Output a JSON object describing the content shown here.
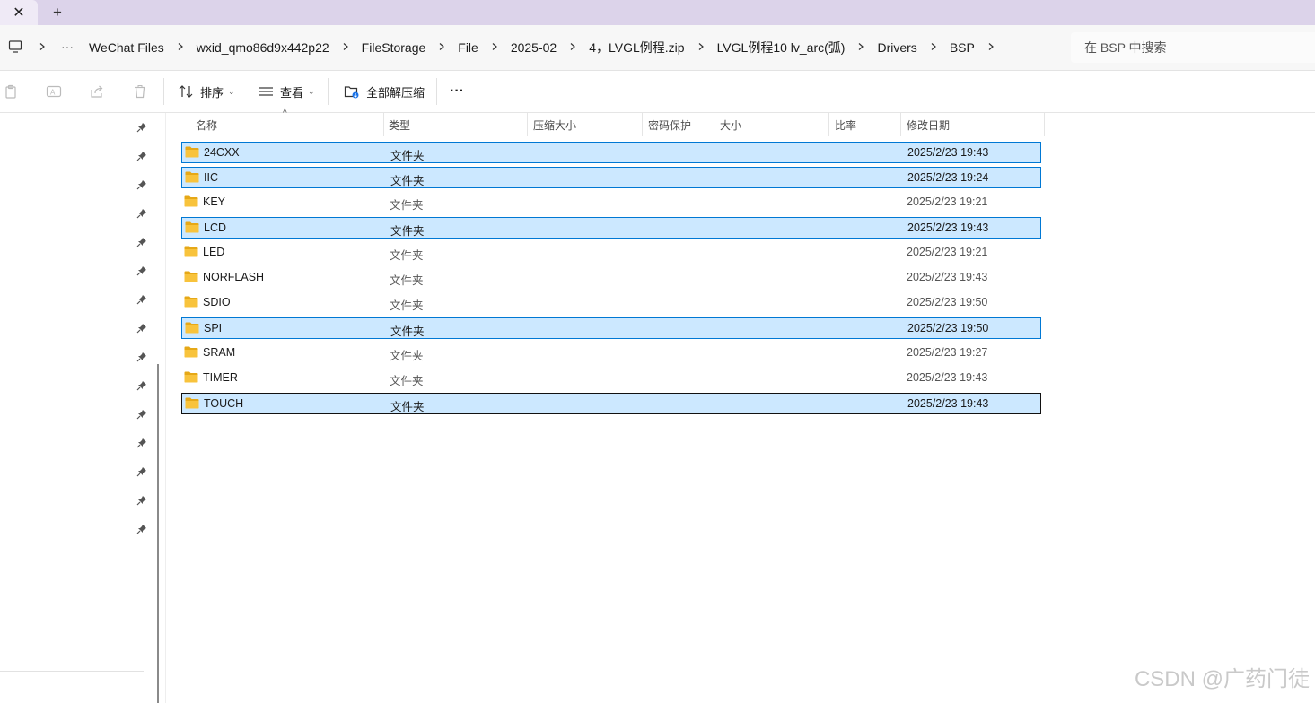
{
  "tabs": {
    "close_symbol": "✕",
    "new_symbol": "+"
  },
  "breadcrumb": {
    "items": [
      "WeChat Files",
      "wxid_qmo86d9x442p22",
      "FileStorage",
      "File",
      "2025-02",
      "4，LVGL例程.zip",
      "LVGL例程10 lv_arc(弧)",
      "Drivers",
      "BSP"
    ]
  },
  "search": {
    "placeholder": "在 BSP 中搜索"
  },
  "commandbar": {
    "sort_label": "排序",
    "view_label": "查看",
    "extract_label": "全部解压缩",
    "more_label": "···"
  },
  "columns": [
    "名称",
    "类型",
    "压缩大小",
    "密码保护",
    "大小",
    "比率",
    "修改日期"
  ],
  "rows": [
    {
      "name": "24CXX",
      "type": "文件夹",
      "date": "2025/2/23 19:43",
      "state": "selected"
    },
    {
      "name": "IIC",
      "type": "文件夹",
      "date": "2025/2/23 19:24",
      "state": "selected"
    },
    {
      "name": "KEY",
      "type": "文件夹",
      "date": "2025/2/23 19:21",
      "state": "normal"
    },
    {
      "name": "LCD",
      "type": "文件夹",
      "date": "2025/2/23 19:43",
      "state": "selected"
    },
    {
      "name": "LED",
      "type": "文件夹",
      "date": "2025/2/23 19:21",
      "state": "normal"
    },
    {
      "name": "NORFLASH",
      "type": "文件夹",
      "date": "2025/2/23 19:43",
      "state": "normal"
    },
    {
      "name": "SDIO",
      "type": "文件夹",
      "date": "2025/2/23 19:50",
      "state": "normal"
    },
    {
      "name": "SPI",
      "type": "文件夹",
      "date": "2025/2/23 19:50",
      "state": "selected"
    },
    {
      "name": "SRAM",
      "type": "文件夹",
      "date": "2025/2/23 19:27",
      "state": "normal"
    },
    {
      "name": "TIMER",
      "type": "文件夹",
      "date": "2025/2/23 19:43",
      "state": "normal"
    },
    {
      "name": "TOUCH",
      "type": "文件夹",
      "date": "2025/2/23 19:43",
      "state": "focused"
    }
  ],
  "watermark": "CSDN @广药门徒",
  "colors": {
    "selection_bg": "#cce8ff",
    "selection_border": "#0078d4",
    "tabstrip": "#dcd3ea",
    "folder": "#f8c33c"
  }
}
